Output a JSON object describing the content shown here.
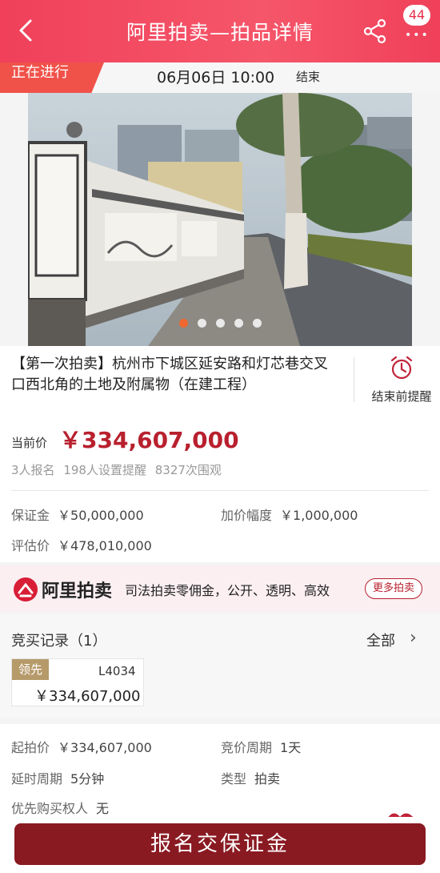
{
  "nav": {
    "title": "阿里拍卖—拍品详情",
    "badge": "44",
    "more_dots": "•••"
  },
  "status": {
    "flag": "正在进行",
    "time": "06月06日 10:00",
    "end_label": "结束"
  },
  "carousel": {
    "count": 5,
    "active_index": 0
  },
  "item": {
    "title": "【第一次拍卖】杭州市下城区延安路和灯芯巷交叉口西北角的土地及附属物（在建工程）",
    "remind_label": "结束前提醒",
    "price_label": "当前价",
    "price": "￥334,607,000",
    "stats": [
      "3人报名",
      "198人设置提醒",
      "8327次围观"
    ],
    "deposit_label": "保证金",
    "deposit": "￥50,000,000",
    "increment_label": "加价幅度",
    "increment": "￥1,000,000",
    "appraisal_label": "评估价",
    "appraisal": "￥478,010,000"
  },
  "ali": {
    "brand": "阿里拍卖",
    "slogan": "司法拍卖零佣金，公开、透明、高效",
    "more_button": "更多拍卖"
  },
  "bids": {
    "title": "竞买记录（1）",
    "all_label": "全部",
    "records": [
      {
        "status": "领先",
        "bidder": "L4034",
        "amount": "￥334,607,000"
      }
    ]
  },
  "details": {
    "start_price_label": "起拍价",
    "start_price": "￥334,607,000",
    "period_label": "竞价周期",
    "period": "1天",
    "delay_label": "延时周期",
    "delay": "5分钟",
    "type_label": "类型",
    "type": "拍卖",
    "priority_label": "优先购买权人",
    "priority": "无"
  },
  "cta": {
    "label": "报名交保证金"
  },
  "colors": {
    "brand_red": "#f0405a",
    "price_red": "#b8202e",
    "cta": "#8a1a22",
    "lead_gold": "#b69a6a"
  },
  "icons": [
    "back-arrow-icon",
    "share-icon",
    "more-icon",
    "alarm-clock-icon",
    "ali-auction-logo",
    "chevron-right-icon",
    "gift-icon"
  ]
}
